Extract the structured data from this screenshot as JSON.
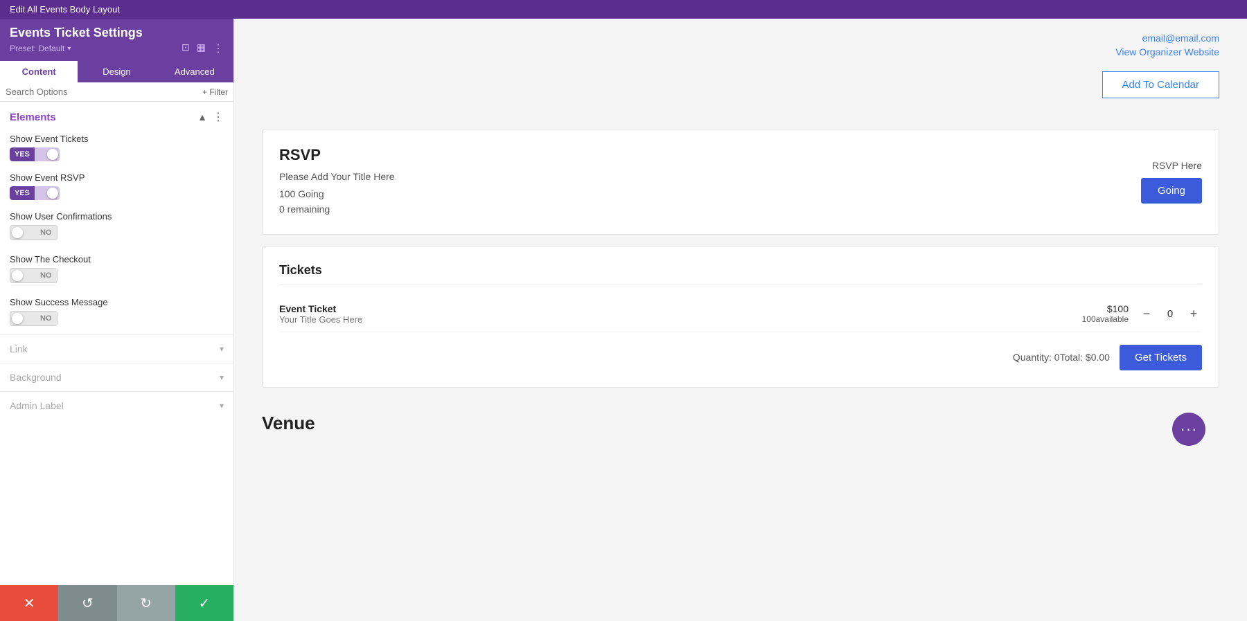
{
  "topBar": {
    "title": "Edit All Events Body Layout"
  },
  "sidebar": {
    "widgetTitle": "Events Ticket Settings",
    "preset": "Preset: Default",
    "tabs": [
      {
        "label": "Content",
        "active": true
      },
      {
        "label": "Design",
        "active": false
      },
      {
        "label": "Advanced",
        "active": false
      }
    ],
    "search": {
      "placeholder": "Search Options",
      "filterLabel": "+ Filter"
    },
    "elements": {
      "sectionTitle": "Elements",
      "items": [
        {
          "label": "Show Event Tickets",
          "toggleState": "yes"
        },
        {
          "label": "Show Event RSVP",
          "toggleState": "yes"
        },
        {
          "label": "Show User Confirmations",
          "toggleState": "no"
        },
        {
          "label": "Show The Checkout",
          "toggleState": "no"
        },
        {
          "label": "Show Success Message",
          "toggleState": "no"
        }
      ]
    },
    "collapsible": [
      {
        "label": "Link"
      },
      {
        "label": "Background"
      },
      {
        "label": "Admin Label"
      }
    ]
  },
  "bottomBar": {
    "close": "✕",
    "undo": "↺",
    "redo": "↻",
    "save": "✓"
  },
  "content": {
    "organizer": {
      "email": "email@email.com",
      "websiteLabel": "View Organizer Website"
    },
    "addToCalendar": "Add To Calendar",
    "rsvp": {
      "title": "RSVP",
      "subtitle": "Please Add Your Title Here",
      "going": "100 Going",
      "remaining": "0 remaining",
      "rsvpHere": "RSVP Here",
      "goingBtn": "Going"
    },
    "tickets": {
      "title": "Tickets",
      "event": {
        "name": "Event Ticket",
        "subtitle": "Your Title Goes Here",
        "price": "$100",
        "available": "100available",
        "qty": "0"
      },
      "footer": {
        "quantityTotal": "Quantity: 0Total: $0.00",
        "getTickets": "Get Tickets"
      }
    },
    "venue": {
      "title": "Venue",
      "floatingBtnIcon": "···"
    }
  }
}
